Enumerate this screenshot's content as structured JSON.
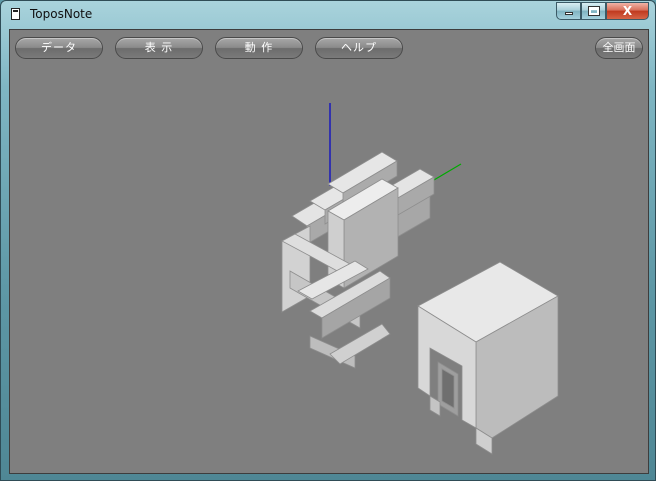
{
  "window": {
    "title": "ToposNote",
    "close_glyph": "X"
  },
  "toolbar": {
    "data_label": "データ",
    "view_label": "表 示",
    "action_label": "動 作",
    "help_label": "ヘルプ",
    "fullscreen_label": "全画面"
  },
  "scene": {
    "background": "#7f7f7f",
    "model_color": "#c8c8c8",
    "axis_colors": {
      "z": "#0000cc",
      "y": "#00aa00"
    }
  }
}
